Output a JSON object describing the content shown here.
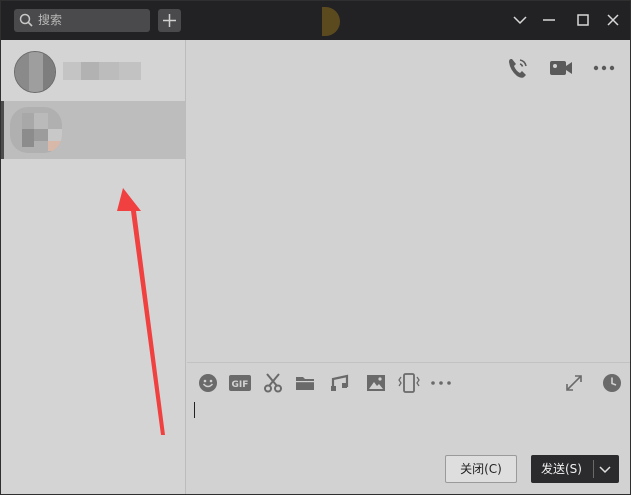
{
  "titlebar": {
    "search_placeholder": "搜索",
    "search_icon": "search-icon",
    "add_icon": "plus-icon",
    "controls": [
      "chevron-down-icon",
      "minimize-icon",
      "maximize-icon",
      "close-icon"
    ]
  },
  "contacts": [
    {
      "avatar": "blurred-avatar",
      "name": ""
    },
    {
      "avatar": "blurred-avatar",
      "name": "",
      "selected": true
    }
  ],
  "chat_header": {
    "icons": [
      "voice-call-icon",
      "video-call-icon",
      "more-icon"
    ]
  },
  "toolbar": {
    "icons": [
      "emoji-icon",
      "gif-icon",
      "scissors-icon",
      "folder-icon",
      "music-icon",
      "image-icon",
      "phone-shake-icon",
      "more-dots-icon",
      "expand-icon",
      "history-clock-icon"
    ],
    "gif_label": "GIF"
  },
  "buttons": {
    "close_label": "关闭(C)",
    "send_label": "发送(S)"
  },
  "colors": {
    "titlebar": "#222224",
    "panel": "#d4d4d4",
    "selected": "#bdbdbd",
    "annotation_arrow": "#f04040"
  }
}
